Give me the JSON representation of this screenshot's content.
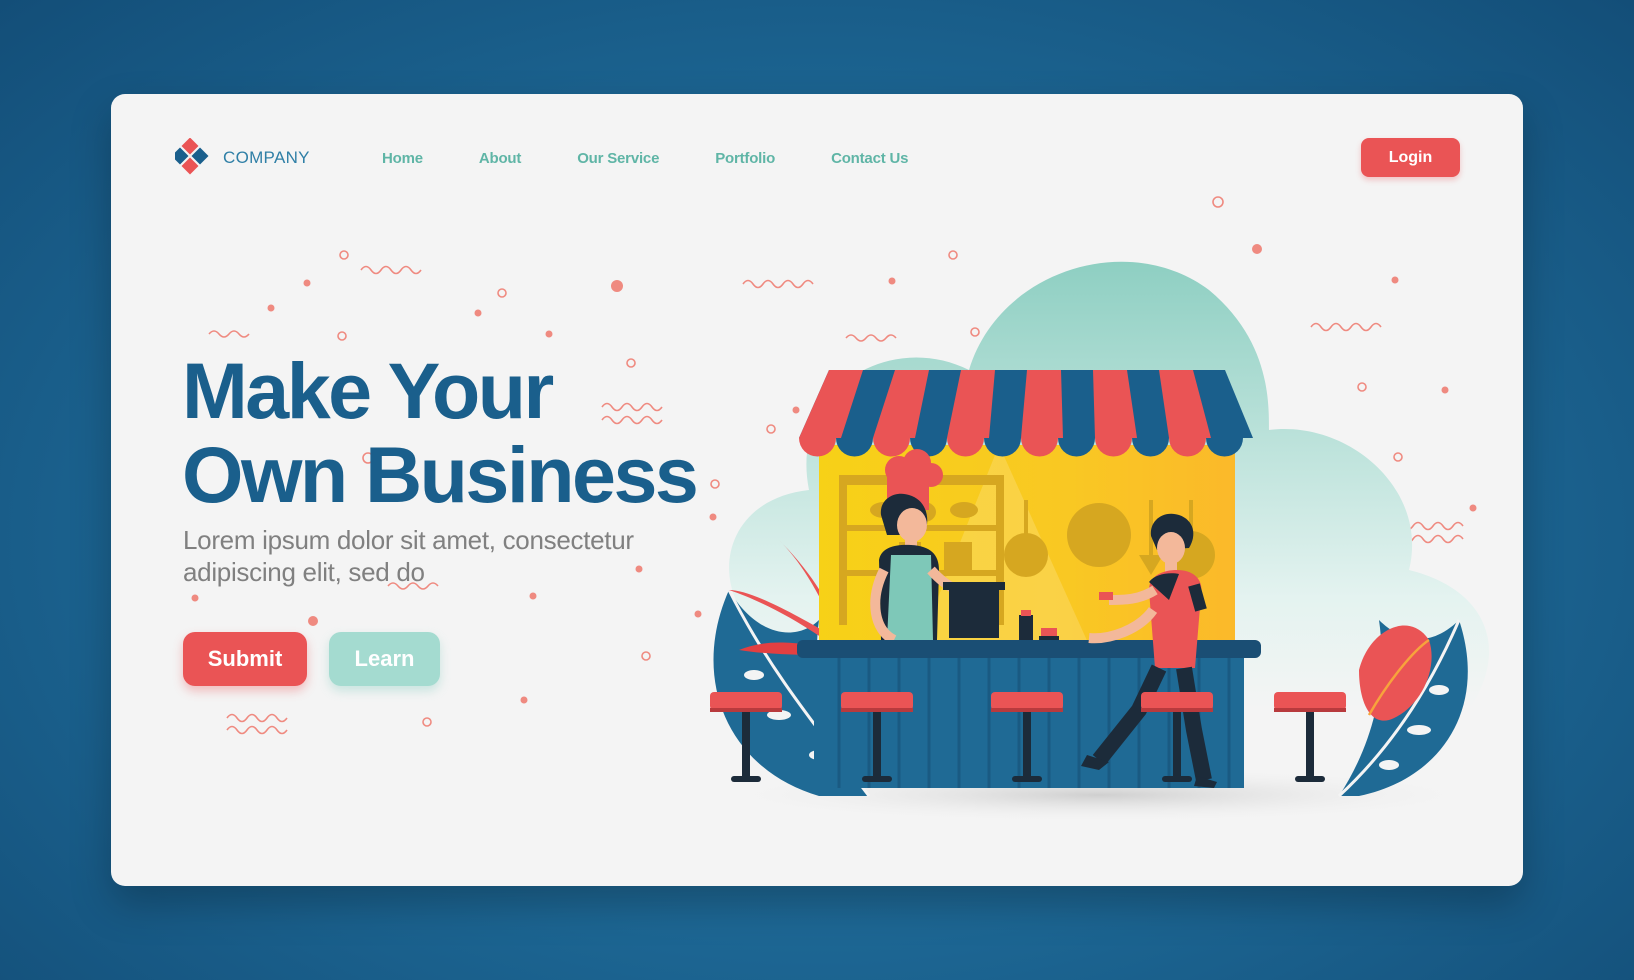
{
  "brand": {
    "name": "COMPANY"
  },
  "nav": {
    "items": [
      {
        "label": "Home"
      },
      {
        "label": "About"
      },
      {
        "label": "Our Service"
      },
      {
        "label": "Portfolio"
      },
      {
        "label": "Contact Us"
      }
    ],
    "login_label": "Login"
  },
  "hero": {
    "title_line1": "Make Your",
    "title_line2": "Own Business",
    "subtitle_line1": "Lorem ipsum dolor sit amet, consectetur",
    "subtitle_line2": "adipiscing elit, sed do",
    "submit_label": "Submit",
    "learn_label": "Learn"
  },
  "colors": {
    "background": "#1c6592",
    "card": "#f4f4f4",
    "primary_red": "#ea5455",
    "teal": "#a4dbd0",
    "navy": "#1a5f8c",
    "yellow": "#f7d117"
  },
  "icons": [
    "company-logo-icon",
    "food-stall-illustration"
  ]
}
